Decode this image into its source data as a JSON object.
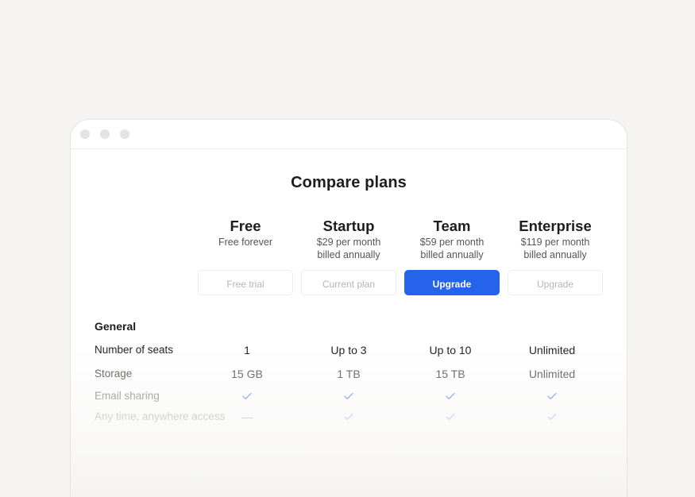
{
  "title": "Compare plans",
  "plans": [
    {
      "name": "Free",
      "price": "Free forever",
      "billing": "",
      "button": "Free trial"
    },
    {
      "name": "Startup",
      "price": "$29 per month",
      "billing": "billed annually",
      "button": "Current plan"
    },
    {
      "name": "Team",
      "price": "$59 per month",
      "billing": "billed annually",
      "button": "Upgrade"
    },
    {
      "name": "Enterprise",
      "price": "$119 per month",
      "billing": "billed annually",
      "button": "Upgrade"
    }
  ],
  "sections": [
    {
      "title": "General",
      "rows": [
        {
          "label": "Number of seats",
          "values": [
            "1",
            "Up to 3",
            "Up to 10",
            "Unlimited"
          ]
        },
        {
          "label": "Storage",
          "values": [
            "15 GB",
            "1 TB",
            "15 TB",
            "Unlimited"
          ]
        },
        {
          "label": "Email sharing",
          "values": [
            "check-icon",
            "check-icon",
            "check-icon",
            "check-icon"
          ]
        },
        {
          "label": "Any time, anywhere access",
          "values": [
            "—",
            "check-icon",
            "check-icon",
            "check-icon"
          ]
        }
      ]
    }
  ],
  "colors": {
    "accent": "#2563eb",
    "check": "#2563eb",
    "background": "#f5f4f2"
  }
}
